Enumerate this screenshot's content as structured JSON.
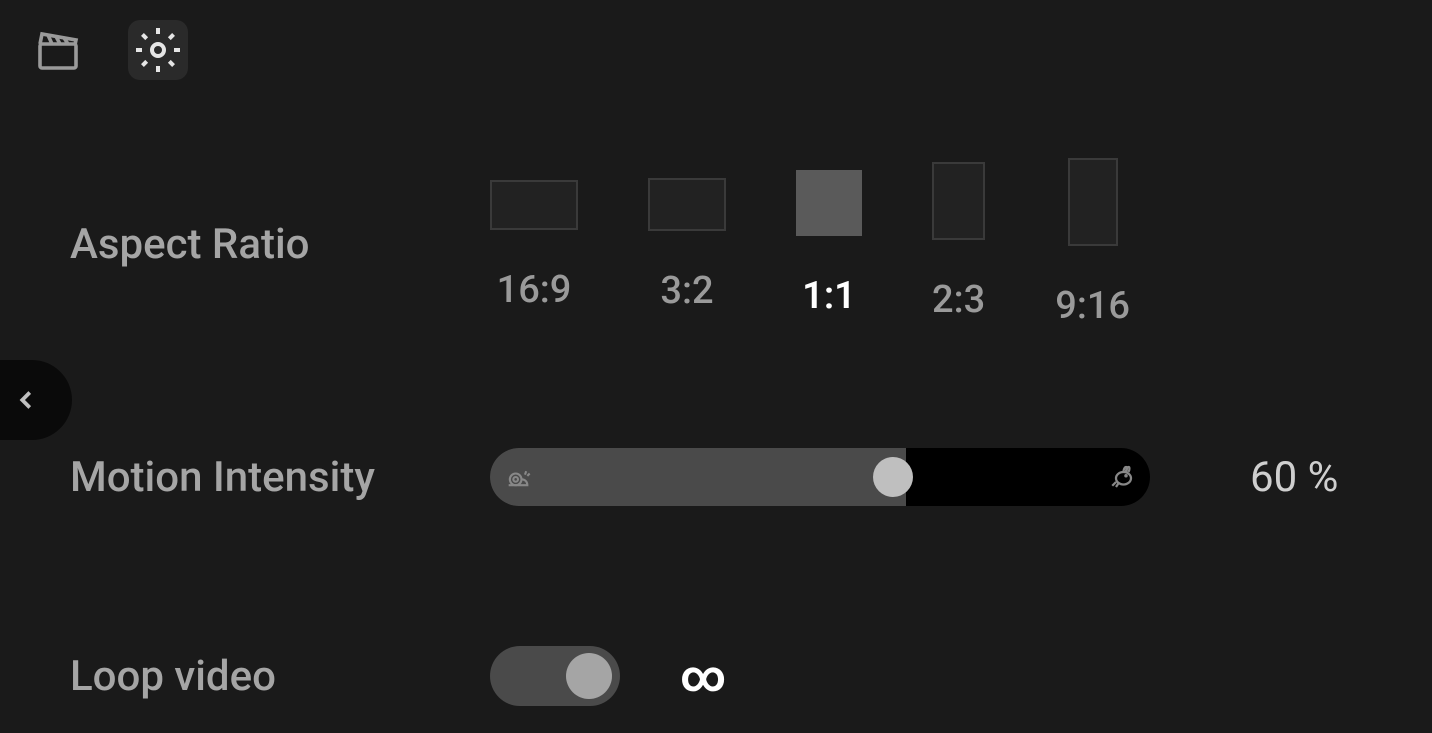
{
  "toolbar": {
    "clapperboard_active": false,
    "settings_active": true
  },
  "settings": {
    "aspect_ratio": {
      "label": "Aspect Ratio",
      "options": [
        {
          "label": "16:9",
          "selected": false
        },
        {
          "label": "3:2",
          "selected": false
        },
        {
          "label": "1:1",
          "selected": true
        },
        {
          "label": "2:3",
          "selected": false
        },
        {
          "label": "9:16",
          "selected": false
        }
      ]
    },
    "motion_intensity": {
      "label": "Motion Intensity",
      "value": 60,
      "display": "60 %"
    },
    "loop_video": {
      "label": "Loop video",
      "enabled": true,
      "icon": "∞"
    }
  }
}
